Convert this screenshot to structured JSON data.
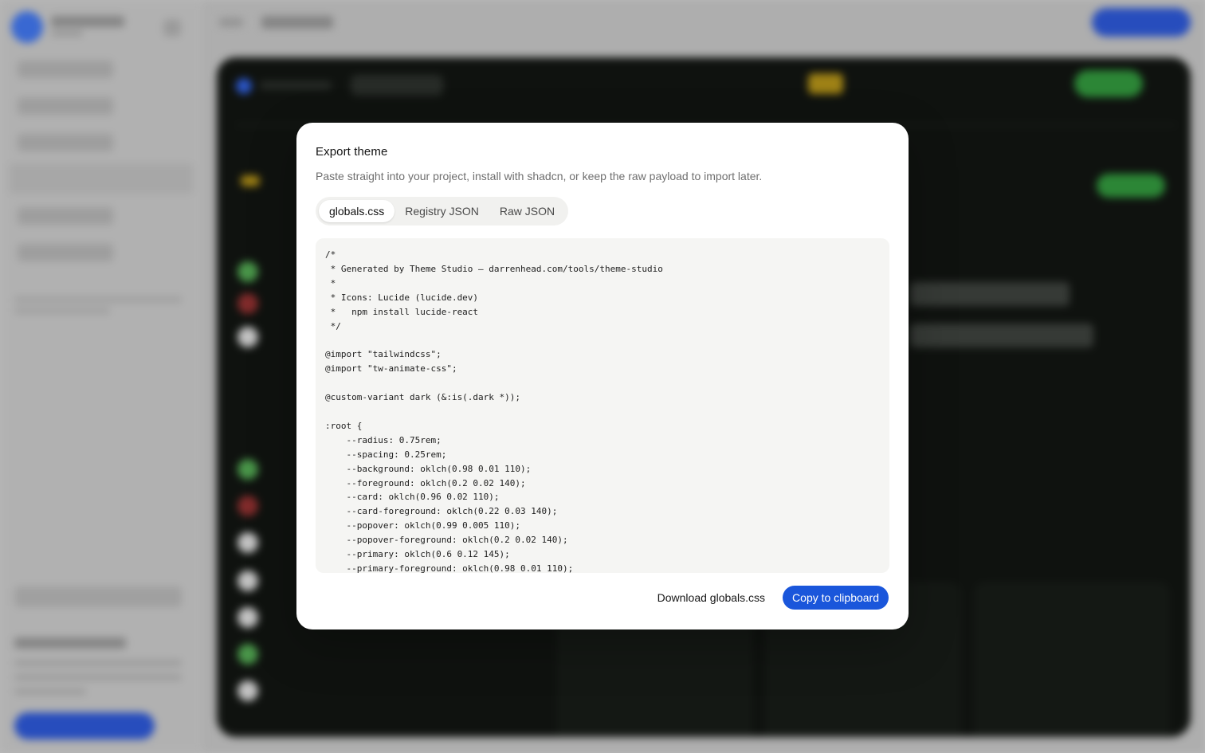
{
  "colors": {
    "accent": "#1a56db",
    "modal_bg": "#ffffff",
    "code_bg": "#f5f5f3"
  },
  "modal": {
    "title": "Export theme",
    "description": "Paste straight into your project, install with shadcn, or keep the raw payload to import later.",
    "tabs": [
      {
        "label": "globals.css",
        "active": true
      },
      {
        "label": "Registry JSON",
        "active": false
      },
      {
        "label": "Raw JSON",
        "active": false
      }
    ],
    "code": "/*\n * Generated by Theme Studio — darrenhead.com/tools/theme-studio\n *\n * Icons: Lucide (lucide.dev)\n *   npm install lucide-react\n */\n\n@import \"tailwindcss\";\n@import \"tw-animate-css\";\n\n@custom-variant dark (&:is(.dark *));\n\n:root {\n    --radius: 0.75rem;\n    --spacing: 0.25rem;\n    --background: oklch(0.98 0.01 110);\n    --foreground: oklch(0.2 0.02 140);\n    --card: oklch(0.96 0.02 110);\n    --card-foreground: oklch(0.22 0.03 140);\n    --popover: oklch(0.99 0.005 110);\n    --popover-foreground: oklch(0.2 0.02 140);\n    --primary: oklch(0.6 0.12 145);\n    --primary-foreground: oklch(0.98 0.01 110);",
    "download_label": "Download globals.css",
    "copy_label": "Copy to clipboard"
  }
}
